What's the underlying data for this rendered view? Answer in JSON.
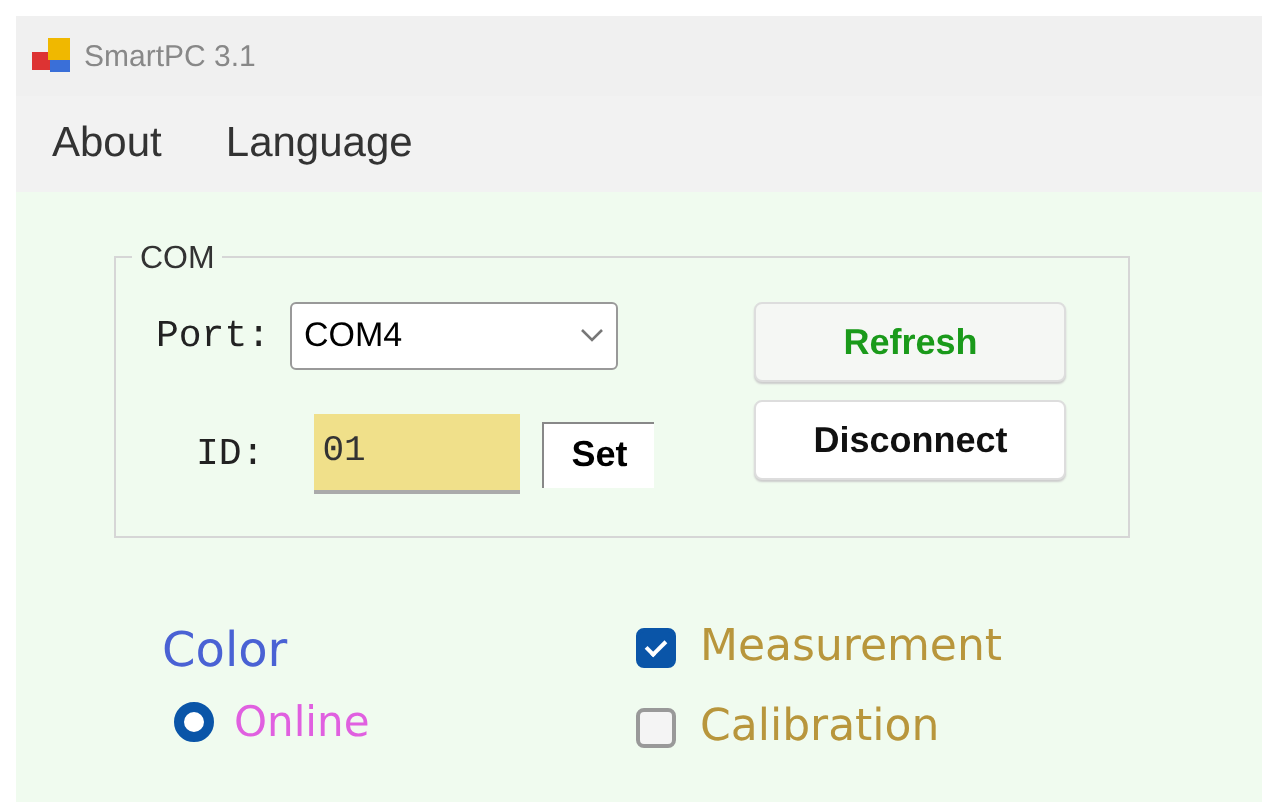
{
  "window": {
    "title": "SmartPC 3.1"
  },
  "menu": [
    "About",
    "Language"
  ],
  "com": {
    "title": "COM",
    "port_label": "Port:",
    "port_value": "COM4",
    "id_label": "ID:",
    "id_value": "01",
    "set_button": "Set",
    "refresh_button": "Refresh",
    "disconnect_button": "Disconnect"
  },
  "color": {
    "title": "Color",
    "radios": [
      {
        "label": "Online",
        "selected": true
      }
    ]
  },
  "checks": [
    {
      "label": "Measurement",
      "checked": true
    },
    {
      "label": "Calibration",
      "checked": false
    }
  ]
}
